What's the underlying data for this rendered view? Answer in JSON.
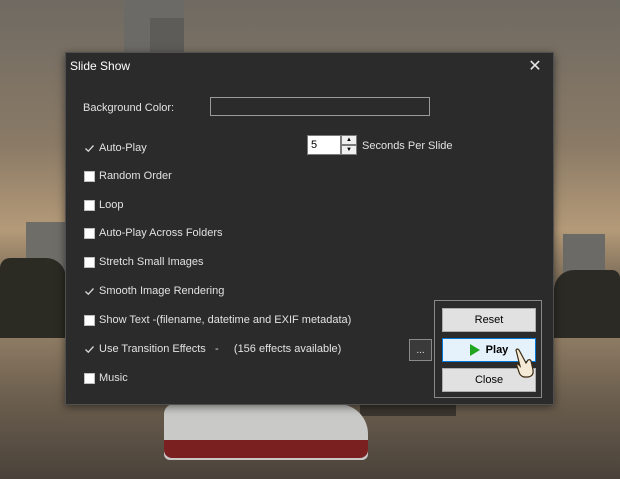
{
  "dialog": {
    "title": "Slide Show",
    "background_color_label": "Background Color:",
    "options": [
      {
        "label": "Auto-Play",
        "checked": true
      },
      {
        "label": "Random Order",
        "checked": false
      },
      {
        "label": "Loop",
        "checked": false
      },
      {
        "label": "Auto-Play Across Folders",
        "checked": false
      },
      {
        "label": "Stretch Small Images",
        "checked": false
      },
      {
        "label": "Smooth Image Rendering",
        "checked": true
      },
      {
        "label": "Show Text -(filename, datetime and EXIF metadata)",
        "checked": false
      },
      {
        "label": "Use Transition Effects   -     (156 effects available)",
        "checked": true
      },
      {
        "label": "Music",
        "checked": false
      }
    ],
    "seconds_value": "5",
    "seconds_label": "Seconds Per Slide",
    "transition_settings_label": "...",
    "buttons": {
      "reset": "Reset",
      "play": "Play",
      "close": "Close"
    }
  },
  "icons": {
    "close": "close-icon",
    "check": "checkmark-icon",
    "play": "play-icon",
    "cursor": "hand-cursor-icon"
  },
  "colors": {
    "dialog_bg": "#2b2b2b",
    "play_accent": "#0078d7",
    "play_icon": "#1fa51f"
  }
}
